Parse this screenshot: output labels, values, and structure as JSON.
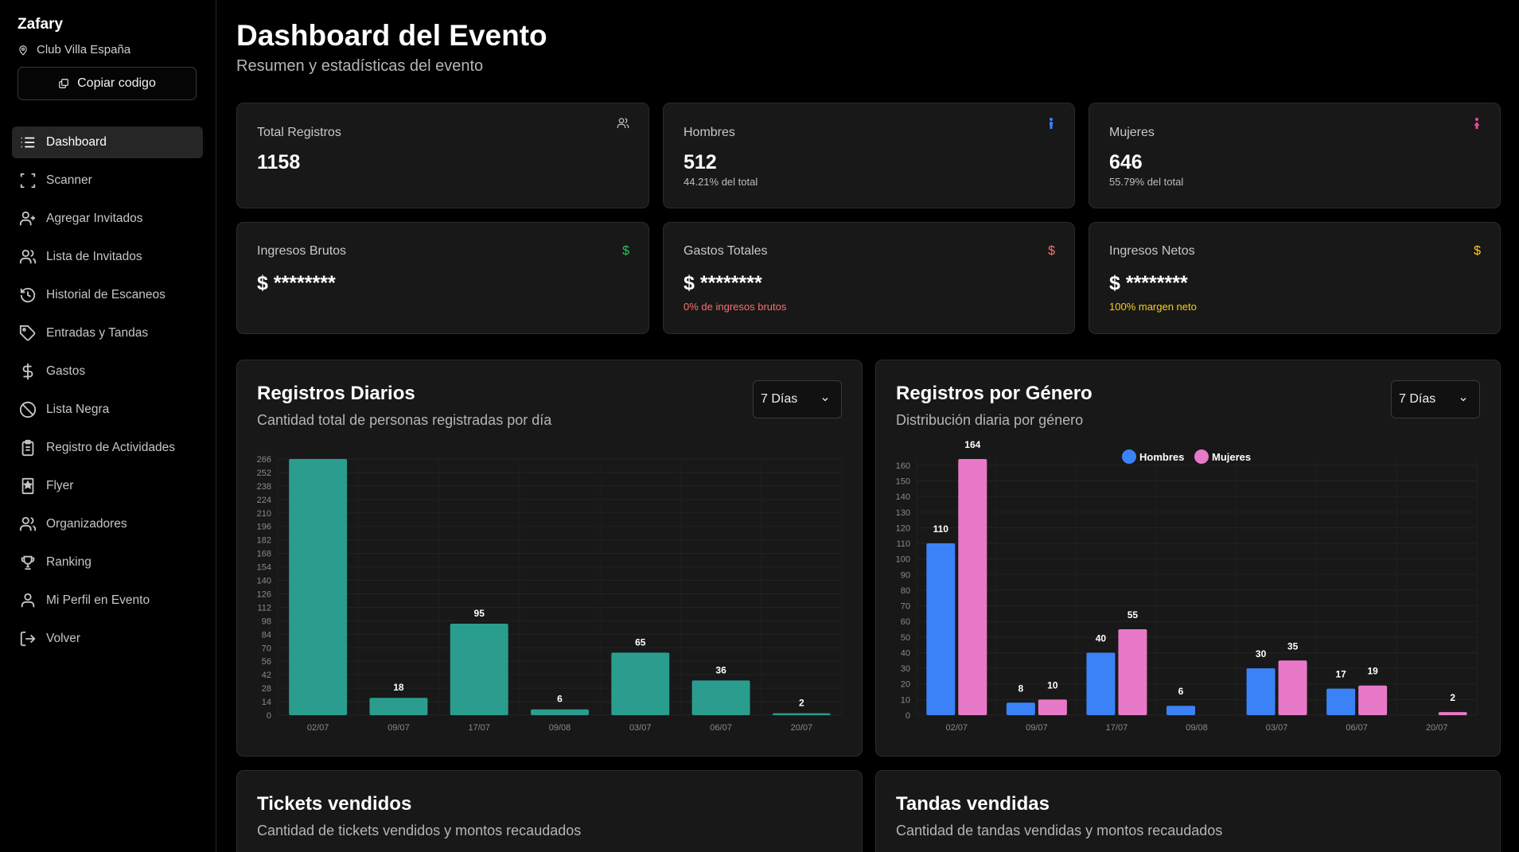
{
  "sidebar": {
    "brand": "Zafary",
    "location": "Club Villa España",
    "copy_label": "Copiar codigo",
    "items": [
      {
        "label": "Dashboard",
        "icon": "list-icon"
      },
      {
        "label": "Scanner",
        "icon": "scan-icon"
      },
      {
        "label": "Agregar Invitados",
        "icon": "user-plus-icon"
      },
      {
        "label": "Lista de Invitados",
        "icon": "users-icon"
      },
      {
        "label": "Historial de Escaneos",
        "icon": "history-icon"
      },
      {
        "label": "Entradas y Tandas",
        "icon": "tag-icon"
      },
      {
        "label": "Gastos",
        "icon": "dollar-icon"
      },
      {
        "label": "Lista Negra",
        "icon": "ban-icon"
      },
      {
        "label": "Registro de Actividades",
        "icon": "clipboard-icon"
      },
      {
        "label": "Flyer",
        "icon": "flyer-icon"
      },
      {
        "label": "Organizadores",
        "icon": "users-icon"
      },
      {
        "label": "Ranking",
        "icon": "trophy-icon"
      },
      {
        "label": "Mi Perfil en Evento",
        "icon": "user-icon"
      },
      {
        "label": "Volver",
        "icon": "logout-icon"
      }
    ]
  },
  "header": {
    "title": "Dashboard del Evento",
    "subtitle": "Resumen y estadísticas del evento"
  },
  "stats": {
    "total": {
      "label": "Total Registros",
      "value": "1158"
    },
    "hombres": {
      "label": "Hombres",
      "value": "512",
      "sub": "44.21% del total"
    },
    "mujeres": {
      "label": "Mujeres",
      "value": "646",
      "sub": "55.79% del total"
    },
    "ingresos_brutos": {
      "label": "Ingresos Brutos",
      "value": "$ ********"
    },
    "gastos": {
      "label": "Gastos Totales",
      "value": "$ ********",
      "sub": "0% de ingresos brutos"
    },
    "ingresos_netos": {
      "label": "Ingresos Netos",
      "value": "$ ********",
      "sub": "100% margen neto"
    }
  },
  "colors": {
    "teal": "#2a9d8f",
    "blue": "#3b82f6",
    "pink": "#e879c9",
    "green": "#22c55e",
    "red": "#f87171",
    "yellow": "#facc15"
  },
  "daily": {
    "title": "Registros Diarios",
    "subtitle": "Cantidad total de personas registradas por día",
    "select": "7 Días"
  },
  "gender": {
    "title": "Registros por Género",
    "subtitle": "Distribución diaria por género",
    "select": "7 Días"
  },
  "tickets": {
    "title": "Tickets vendidos",
    "subtitle": "Cantidad de tickets vendidos y montos recaudados"
  },
  "tandas": {
    "title": "Tandas vendidas",
    "subtitle": "Cantidad de tandas vendidas y montos recaudados"
  },
  "chart_data": [
    {
      "type": "bar",
      "categories": [
        "02/07",
        "09/07",
        "17/07",
        "09/08",
        "03/07",
        "06/07",
        "20/07"
      ],
      "values": [
        266,
        18,
        95,
        6,
        65,
        36,
        2
      ],
      "data_labels": [
        "",
        "18",
        "95",
        "6",
        "65",
        "36",
        "2"
      ],
      "yticks": [
        0,
        14,
        28,
        42,
        56,
        70,
        84,
        98,
        112,
        126,
        140,
        154,
        168,
        182,
        196,
        210,
        224,
        238,
        252,
        266
      ],
      "ylim": [
        0,
        266
      ],
      "color": "#2a9d8f"
    },
    {
      "type": "bar",
      "categories": [
        "02/07",
        "09/07",
        "17/07",
        "09/08",
        "03/07",
        "06/07",
        "20/07"
      ],
      "series": [
        {
          "name": "Hombres",
          "values": [
            110,
            8,
            40,
            6,
            30,
            17,
            0
          ],
          "color": "#3b82f6"
        },
        {
          "name": "Mujeres",
          "values": [
            164,
            10,
            55,
            0,
            35,
            19,
            2
          ],
          "color": "#e879c9"
        }
      ],
      "yticks": [
        0,
        10,
        20,
        30,
        40,
        50,
        60,
        70,
        80,
        90,
        100,
        110,
        120,
        130,
        140,
        150,
        160
      ],
      "ylim": [
        0,
        164
      ],
      "legend": "top-center"
    }
  ]
}
